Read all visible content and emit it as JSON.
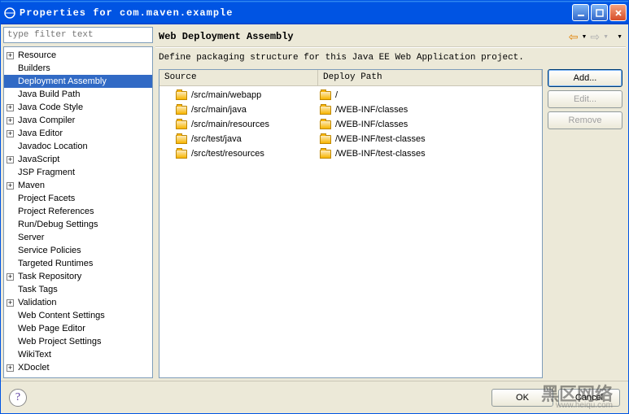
{
  "window": {
    "title": "Properties for com.maven.example"
  },
  "filter": {
    "placeholder": "type filter text"
  },
  "tree": [
    {
      "label": "Resource",
      "exp": "+",
      "lvl": 0
    },
    {
      "label": "Builders",
      "exp": "",
      "lvl": 0
    },
    {
      "label": "Deployment Assembly",
      "exp": "",
      "lvl": 0,
      "selected": true
    },
    {
      "label": "Java Build Path",
      "exp": "",
      "lvl": 0
    },
    {
      "label": "Java Code Style",
      "exp": "+",
      "lvl": 0
    },
    {
      "label": "Java Compiler",
      "exp": "+",
      "lvl": 0
    },
    {
      "label": "Java Editor",
      "exp": "+",
      "lvl": 0
    },
    {
      "label": "Javadoc Location",
      "exp": "",
      "lvl": 0
    },
    {
      "label": "JavaScript",
      "exp": "+",
      "lvl": 0
    },
    {
      "label": "JSP Fragment",
      "exp": "",
      "lvl": 0
    },
    {
      "label": "Maven",
      "exp": "+",
      "lvl": 0
    },
    {
      "label": "Project Facets",
      "exp": "",
      "lvl": 0
    },
    {
      "label": "Project References",
      "exp": "",
      "lvl": 0
    },
    {
      "label": "Run/Debug Settings",
      "exp": "",
      "lvl": 0
    },
    {
      "label": "Server",
      "exp": "",
      "lvl": 0
    },
    {
      "label": "Service Policies",
      "exp": "",
      "lvl": 0
    },
    {
      "label": "Targeted Runtimes",
      "exp": "",
      "lvl": 0
    },
    {
      "label": "Task Repository",
      "exp": "+",
      "lvl": 0
    },
    {
      "label": "Task Tags",
      "exp": "",
      "lvl": 0
    },
    {
      "label": "Validation",
      "exp": "+",
      "lvl": 0
    },
    {
      "label": "Web Content Settings",
      "exp": "",
      "lvl": 0
    },
    {
      "label": "Web Page Editor",
      "exp": "",
      "lvl": 0
    },
    {
      "label": "Web Project Settings",
      "exp": "",
      "lvl": 0
    },
    {
      "label": "WikiText",
      "exp": "",
      "lvl": 0
    },
    {
      "label": "XDoclet",
      "exp": "+",
      "lvl": 0
    }
  ],
  "main": {
    "title": "Web Deployment Assembly",
    "description": "Define packaging structure for this Java EE Web Application project.",
    "columns": {
      "source": "Source",
      "deploy": "Deploy Path"
    },
    "rows": [
      {
        "source": "/src/main/webapp",
        "deploy": "/"
      },
      {
        "source": "/src/main/java",
        "deploy": "/WEB-INF/classes"
      },
      {
        "source": "/src/main/resources",
        "deploy": "/WEB-INF/classes"
      },
      {
        "source": "/src/test/java",
        "deploy": "/WEB-INF/test-classes"
      },
      {
        "source": "/src/test/resources",
        "deploy": "/WEB-INF/test-classes"
      }
    ],
    "buttons": {
      "add": "Add...",
      "edit": "Edit...",
      "remove": "Remove"
    }
  },
  "footer": {
    "ok": "OK",
    "cancel": "Cancel"
  },
  "watermark": {
    "main": "黑区网络",
    "sub": "www.heiqu.com"
  }
}
